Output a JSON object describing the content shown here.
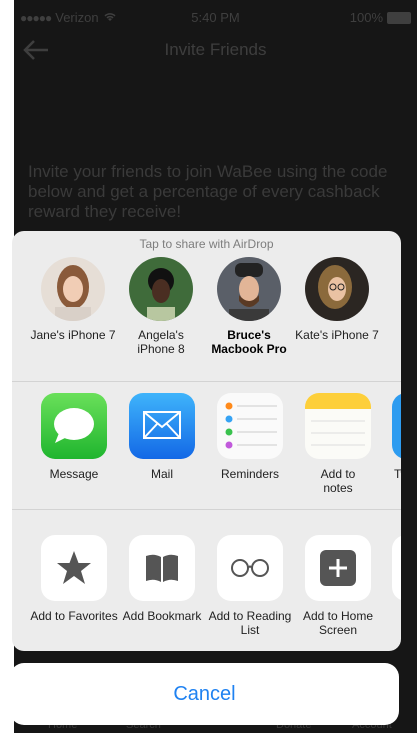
{
  "status": {
    "carrier": "Verizon",
    "time": "5:40 PM",
    "battery": "100%"
  },
  "nav": {
    "title": "Invite Friends"
  },
  "invite_text": "Invite your friends to join WaBee using the code below and get a percentage of every cashback reward they receive!",
  "share": {
    "airdrop_caption": "Tap to share with AirDrop",
    "people": [
      {
        "name": "Jane's iPhone 7"
      },
      {
        "name": "Angela's iPhone 8"
      },
      {
        "name": "Bruce's Macbook Pro"
      },
      {
        "name": "Kate's iPhone 7"
      }
    ],
    "apps": [
      {
        "label": "Message",
        "icon": "message-icon"
      },
      {
        "label": "Mail",
        "icon": "mail-icon"
      },
      {
        "label": "Reminders",
        "icon": "reminders-icon"
      },
      {
        "label": "Add to notes",
        "icon": "notes-icon"
      },
      {
        "label": "Tw",
        "icon": "twitter-icon"
      }
    ],
    "actions": [
      {
        "label": "Add to Favorites",
        "icon": "star-icon"
      },
      {
        "label": "Add Bookmark",
        "icon": "book-icon"
      },
      {
        "label": "Add to Reading List",
        "icon": "glasses-icon"
      },
      {
        "label": "Add to Home Screen",
        "icon": "plus-square-icon"
      }
    ],
    "cancel_label": "Cancel"
  },
  "tabbar": {
    "items": [
      "Home",
      "Search",
      "Donate",
      "Account"
    ]
  },
  "colors": {
    "accent": "#1f82f1",
    "sheet": "#ececec"
  }
}
